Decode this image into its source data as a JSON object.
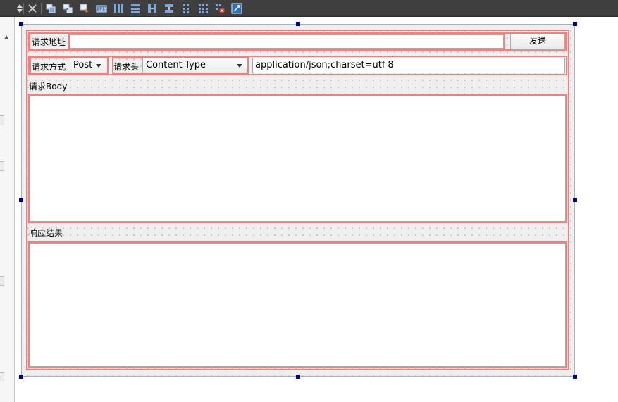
{
  "toolbar": {
    "buttons": [
      {
        "name": "up-down-arrows-icon"
      },
      {
        "name": "close-icon"
      },
      {
        "name": "edit-widgets-icon"
      },
      {
        "name": "edit-signals-slots-icon"
      },
      {
        "name": "edit-buddies-icon"
      },
      {
        "name": "edit-tab-order-icon"
      },
      {
        "name": "lay-out-horizontally-icon"
      },
      {
        "name": "lay-out-vertically-icon"
      },
      {
        "name": "lay-out-horizontal-splitter-icon"
      },
      {
        "name": "lay-out-vertical-splitter-icon"
      },
      {
        "name": "lay-out-form-icon"
      },
      {
        "name": "lay-out-grid-icon"
      },
      {
        "name": "break-layout-icon"
      },
      {
        "name": "adjust-size-icon"
      }
    ]
  },
  "form": {
    "url_row": {
      "label": "请求地址",
      "url_value": "",
      "send_button": "发送"
    },
    "method_row": {
      "method_label": "请求方式",
      "method_value": "Post",
      "header_label": "请求头",
      "header_name_value": "Content-Type",
      "header_value": "application/json;charset=utf-8"
    },
    "request_body": {
      "title": "请求Body",
      "content": ""
    },
    "response": {
      "title": "响应结果",
      "content": ""
    }
  },
  "colors": {
    "toolbar_bg": "#3f3f3f",
    "layout_border": "#f08080",
    "selection_handle": "#000080",
    "canvas_bg": "#efefef"
  }
}
